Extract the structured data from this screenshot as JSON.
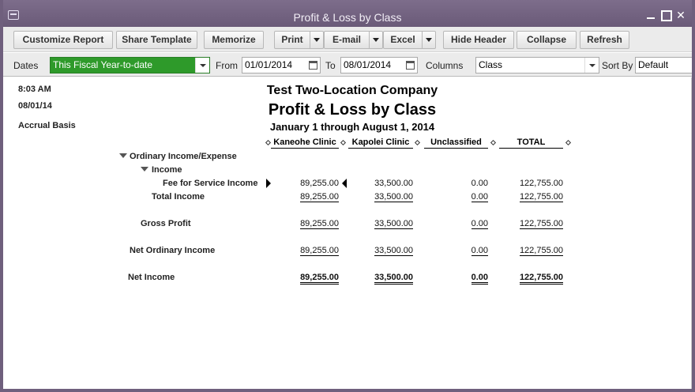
{
  "window": {
    "title": "Profit & Loss by Class"
  },
  "toolbar": {
    "customize": "Customize Report",
    "share": "Share Template",
    "memorize": "Memorize",
    "print": "Print",
    "email": "E-mail",
    "excel": "Excel",
    "hide_header": "Hide Header",
    "collapse": "Collapse",
    "refresh": "Refresh"
  },
  "filters": {
    "dates_label": "Dates",
    "dates_value": "This Fiscal Year-to-date",
    "from_label": "From",
    "from_value": "01/01/2014",
    "to_label": "To",
    "to_value": "08/01/2014",
    "columns_label": "Columns",
    "columns_value": "Class",
    "sortby_label": "Sort By",
    "sortby_value": "Default"
  },
  "report": {
    "time": "8:03 AM",
    "date": "08/01/14",
    "basis": "Accrual Basis",
    "company": "Test Two-Location Company",
    "title": "Profit & Loss by Class",
    "period": "January 1 through August 1, 2014",
    "columns": [
      "Kaneohe Clinic",
      "Kapolei Clinic",
      "Unclassified",
      "TOTAL"
    ],
    "sections": {
      "ordinary": "Ordinary Income/Expense",
      "income": "Income"
    },
    "rows": [
      {
        "label": "Fee for Service Income",
        "values": [
          "89,255.00",
          "33,500.00",
          "0.00",
          "122,755.00"
        ]
      },
      {
        "label": "Total Income",
        "values": [
          "89,255.00",
          "33,500.00",
          "0.00",
          "122,755.00"
        ]
      },
      {
        "label": "Gross Profit",
        "values": [
          "89,255.00",
          "33,500.00",
          "0.00",
          "122,755.00"
        ]
      },
      {
        "label": "Net Ordinary Income",
        "values": [
          "89,255.00",
          "33,500.00",
          "0.00",
          "122,755.00"
        ]
      },
      {
        "label": "Net Income",
        "values": [
          "89,255.00",
          "33,500.00",
          "0.00",
          "122,755.00"
        ]
      }
    ]
  },
  "colors": {
    "titlebar": "#6f5f7d",
    "dates_highlight": "#2e9a2a"
  }
}
